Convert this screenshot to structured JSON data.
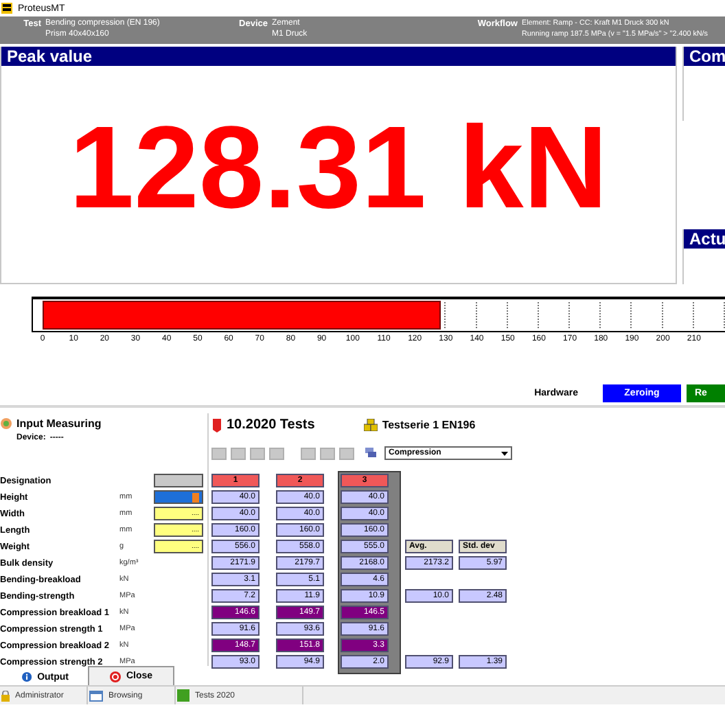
{
  "window": {
    "title": "ProteusMT"
  },
  "info": [
    {
      "label": "Test",
      "lines": [
        "Bending compression (EN 196)",
        "Prism 40x40x160"
      ]
    },
    {
      "label": "Device",
      "lines": [
        "Zement",
        "M1 Druck"
      ]
    },
    {
      "label": "Workflow",
      "lines": [
        "Element: Ramp - CC: Kraft M1 Druck 300 kN",
        "Running ramp 187.5 MPa (v = \"1.5 MPa/s\" > \"2.400 kN/s"
      ]
    }
  ],
  "peak": {
    "title": "Peak value",
    "reading": "128.31 kN"
  },
  "side_panels": [
    "Com",
    "Actu"
  ],
  "gauge": {
    "level": 0.5832,
    "scale_labels": [
      "0",
      "10",
      "20",
      "30",
      "40",
      "50",
      "60",
      "70",
      "80",
      "90",
      "100",
      "110",
      "120",
      "130",
      "140",
      "150",
      "160",
      "170",
      "180",
      "190",
      "200",
      "210"
    ]
  },
  "hardware": {
    "label": "Hardware",
    "buttons": [
      {
        "label": "Zeroing",
        "kind": "zero"
      },
      {
        "label": "Re",
        "kind": "run"
      }
    ]
  },
  "input_measuring": {
    "title": "Input Measuring",
    "device_label": "Device:",
    "device_value": "-----"
  },
  "series": {
    "title": "10.2020 Tests",
    "subtitle": "Testserie 1 EN196",
    "mode": "Compression"
  },
  "columns": [
    {
      "selected": false
    },
    {
      "selected": false
    },
    {
      "selected": true
    }
  ],
  "rows": [
    {
      "label": "Designation",
      "unit": "",
      "input": {
        "kind": "blank"
      },
      "cells": [
        {
          "text": "1",
          "kind": "label"
        },
        {
          "text": "2",
          "kind": "label"
        },
        {
          "text": "3",
          "kind": "label"
        }
      ]
    },
    {
      "label": "Height",
      "unit": "mm",
      "input": {
        "kind": "active"
      },
      "cells": [
        {
          "text": "40.0",
          "kind": "value"
        },
        {
          "text": "40.0",
          "kind": "value"
        },
        {
          "text": "40.0",
          "kind": "value"
        }
      ]
    },
    {
      "label": "Width",
      "unit": "mm",
      "input": {
        "kind": "pick",
        "text": "...."
      },
      "cells": [
        {
          "text": "40.0",
          "kind": "value"
        },
        {
          "text": "40.0",
          "kind": "value"
        },
        {
          "text": "40.0",
          "kind": "value"
        }
      ]
    },
    {
      "label": "Length",
      "unit": "mm",
      "input": {
        "kind": "pick",
        "text": "...."
      },
      "cells": [
        {
          "text": "160.0",
          "kind": "value"
        },
        {
          "text": "160.0",
          "kind": "value"
        },
        {
          "text": "160.0",
          "kind": "value"
        }
      ]
    },
    {
      "label": "Weight",
      "unit": "g",
      "input": {
        "kind": "pick",
        "text": "...."
      },
      "cells": [
        {
          "text": "556.0",
          "kind": "value"
        },
        {
          "text": "558.0",
          "kind": "value"
        },
        {
          "text": "555.0",
          "kind": "value"
        }
      ],
      "summary": [
        {
          "text": "Avg.",
          "kind": "heading"
        },
        {
          "text": "Std. dev",
          "kind": "heading"
        }
      ]
    },
    {
      "label": "Bulk density",
      "unit": "kg/m³",
      "cells": [
        {
          "text": "2171.9",
          "kind": "value"
        },
        {
          "text": "2179.7",
          "kind": "value"
        },
        {
          "text": "2168.0",
          "kind": "value"
        }
      ],
      "summary": [
        {
          "text": "2173.2",
          "kind": "value"
        },
        {
          "text": "5.97",
          "kind": "value"
        }
      ]
    },
    {
      "label": "Bending-breakload",
      "unit": "kN",
      "cells": [
        {
          "text": "3.1",
          "kind": "value"
        },
        {
          "text": "5.1",
          "kind": "value"
        },
        {
          "text": "4.6",
          "kind": "value"
        }
      ]
    },
    {
      "label": "Bending-strength",
      "unit": "MPa",
      "cells": [
        {
          "text": "7.2",
          "kind": "value"
        },
        {
          "text": "11.9",
          "kind": "value"
        },
        {
          "text": "10.9",
          "kind": "value"
        }
      ],
      "summary": [
        {
          "text": "10.0",
          "kind": "value"
        },
        {
          "text": "2.48",
          "kind": "value"
        }
      ]
    },
    {
      "label": "Compression breakload 1",
      "unit": "kN",
      "cells": [
        {
          "text": "146.6",
          "kind": "highlight"
        },
        {
          "text": "149.7",
          "kind": "highlight"
        },
        {
          "text": "146.5",
          "kind": "highlight"
        }
      ]
    },
    {
      "label": "Compression strength 1",
      "unit": "MPa",
      "cells": [
        {
          "text": "91.6",
          "kind": "value"
        },
        {
          "text": "93.6",
          "kind": "value"
        },
        {
          "text": "91.6",
          "kind": "value"
        }
      ]
    },
    {
      "label": "Compression breakload 2",
      "unit": "kN",
      "cells": [
        {
          "text": "148.7",
          "kind": "highlight"
        },
        {
          "text": "151.8",
          "kind": "highlight"
        },
        {
          "text": "3.3",
          "kind": "highlight"
        }
      ]
    },
    {
      "label": "Compression strength 2",
      "unit": "MPa",
      "cells": [
        {
          "text": "93.0",
          "kind": "value"
        },
        {
          "text": "94.9",
          "kind": "value"
        },
        {
          "text": "2.0",
          "kind": "value"
        }
      ],
      "summary": [
        {
          "text": "92.9",
          "kind": "value"
        },
        {
          "text": "1.39",
          "kind": "value"
        }
      ]
    }
  ],
  "tabs": [
    {
      "label": "Output",
      "kind": "info",
      "selected": false
    },
    {
      "label": "Close",
      "kind": "close",
      "selected": true
    }
  ],
  "status_bar": [
    {
      "text": "Administrator",
      "kind": "user"
    },
    {
      "text": "Browsing",
      "kind": "window"
    },
    {
      "text": "Tests 2020",
      "kind": "folder"
    }
  ]
}
